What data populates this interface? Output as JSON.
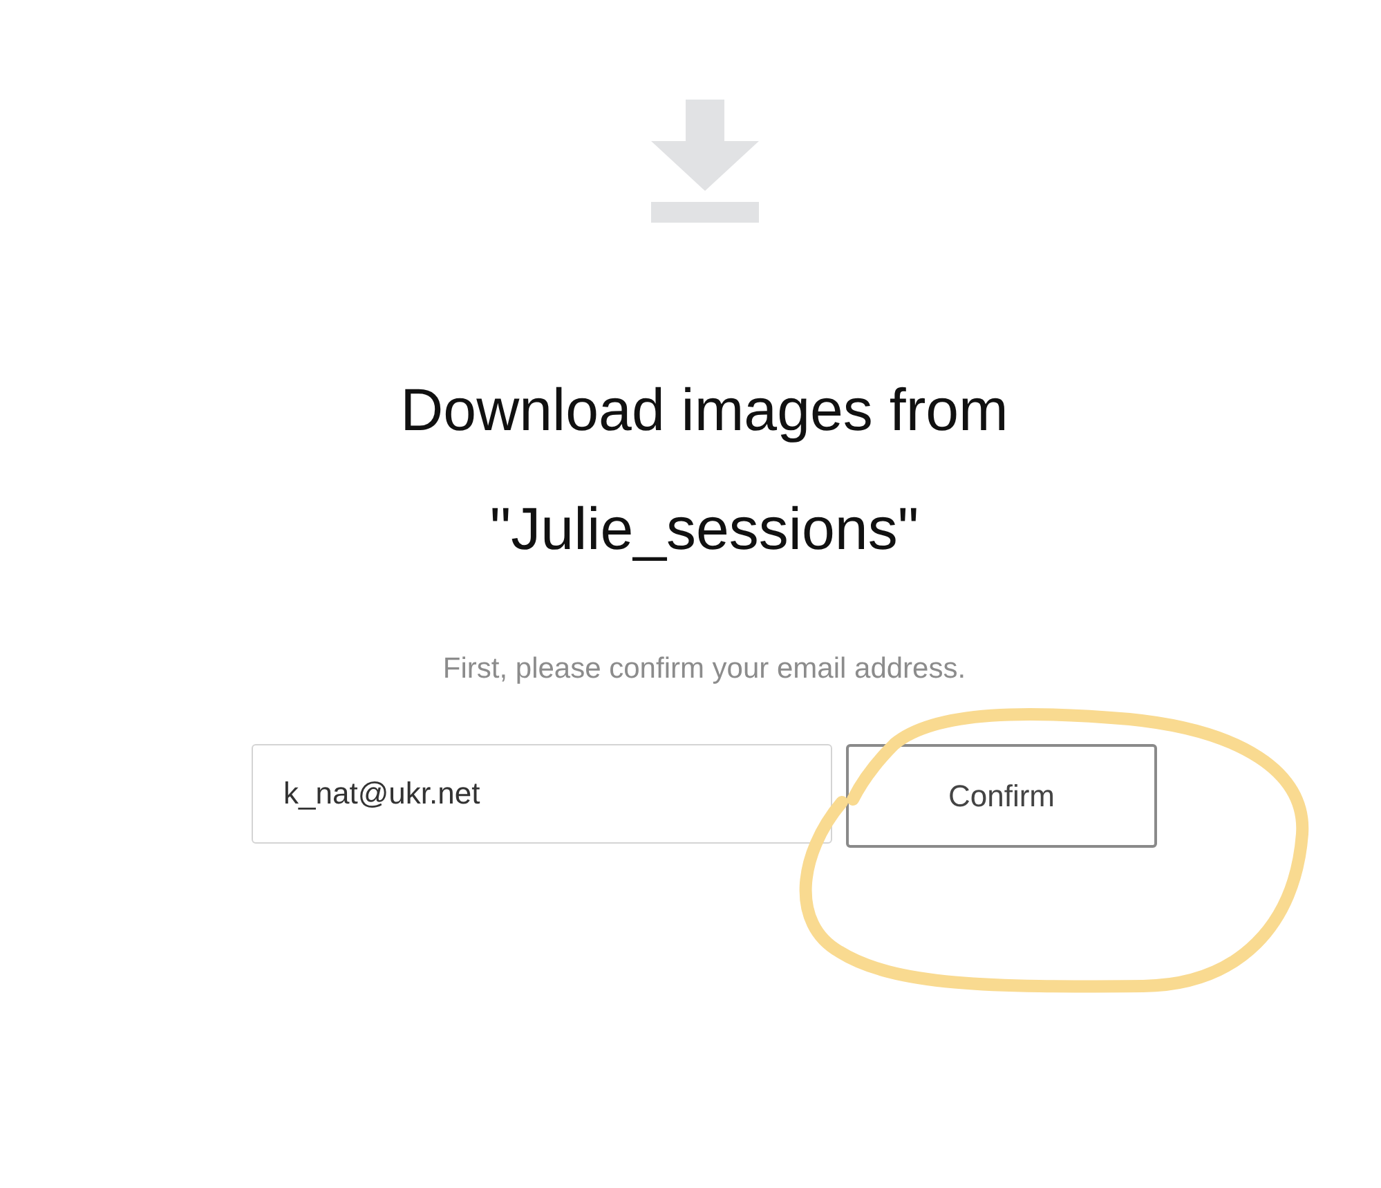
{
  "title_lines": [
    "Download images from",
    "\"Julie_sessions\""
  ],
  "prompt": "First, please confirm your email address.",
  "email_field": {
    "value": "k_nat@ukr.net"
  },
  "confirm_button": {
    "label": "Confirm"
  }
}
